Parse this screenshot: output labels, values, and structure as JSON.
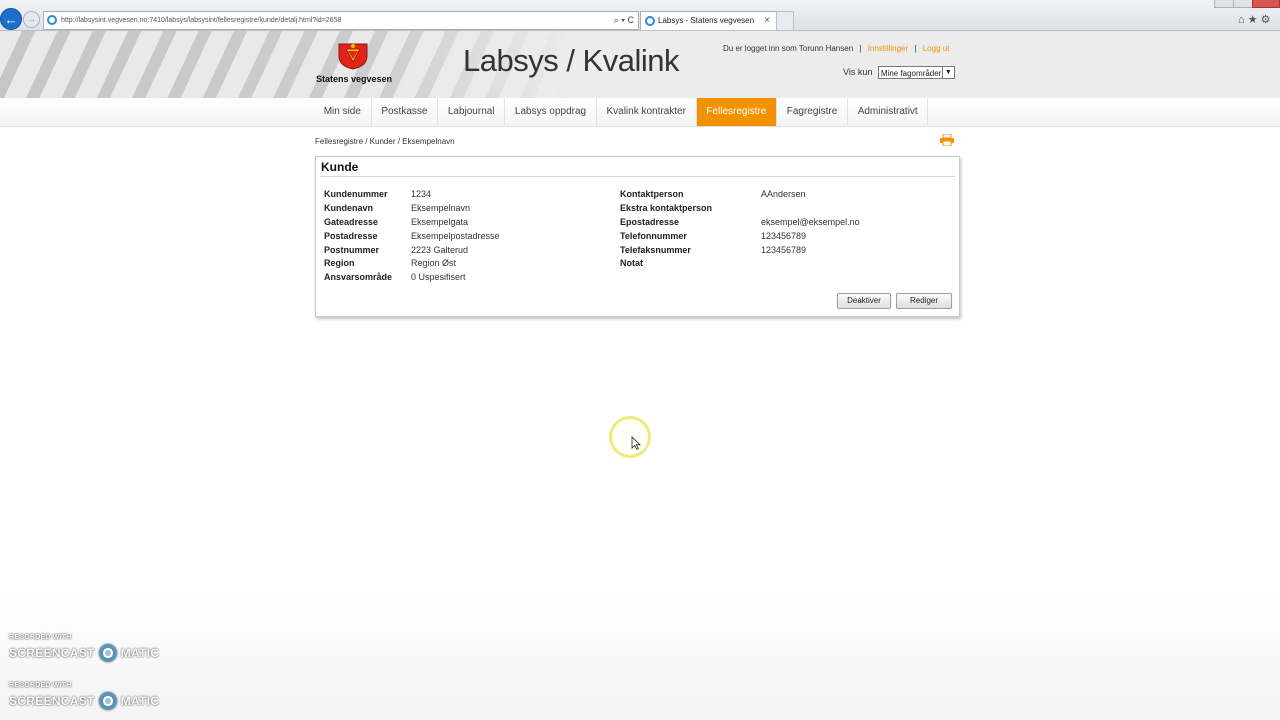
{
  "browser": {
    "url": "http://labsysint.vegvesen.no:7410/labsys/labsysint/fellesregistre/kunde/detalj.html?id=2658",
    "address_tools": "⌕ ▾ C",
    "tab_title": "Labsys - Statens vegvesen",
    "tab_close": "×",
    "right_icons": "⌂ ★ ⚙"
  },
  "header": {
    "logo_text": "Statens vegvesen",
    "app_title": "Labsys / Kvalink",
    "logged_in_text": "Du er logget inn som Torunn Hansen",
    "separator": "|",
    "settings_link": "Innstillinger",
    "logout_link": "Logg ut",
    "filter_label": "Vis kun",
    "filter_value": "Mine fagområder"
  },
  "nav": {
    "items": [
      {
        "label": "Min side"
      },
      {
        "label": "Postkasse"
      },
      {
        "label": "Labjournal"
      },
      {
        "label": "Labsys oppdrag"
      },
      {
        "label": "Kvalink kontrakter"
      },
      {
        "label": "Fellesregistre"
      },
      {
        "label": "Fagregistre"
      },
      {
        "label": "Administrativt"
      }
    ],
    "active": "Fellesregistre",
    "active_color": "#f39200"
  },
  "breadcrumb": "Fellesregistre / Kunder / Eksempelnavn",
  "panel": {
    "title": "Kunde",
    "left_fields": [
      {
        "label": "Kundenummer",
        "value": "1234"
      },
      {
        "label": "Kundenavn",
        "value": "Eksempelnavn"
      },
      {
        "label": "Gateadresse",
        "value": "Eksempelgata"
      },
      {
        "label": "Postadresse",
        "value": "Eksempelpostadresse"
      },
      {
        "label": "Postnummer",
        "value": "2223 Galterud"
      },
      {
        "label": "Region",
        "value": "Region Øst"
      },
      {
        "label": "Ansvarsområde",
        "value": "0 Uspesifisert"
      }
    ],
    "right_fields": [
      {
        "label": "Kontaktperson",
        "value": "AAndersen"
      },
      {
        "label": "Ekstra kontaktperson",
        "value": ""
      },
      {
        "label": "Epostadresse",
        "value": "eksempel@eksempel.no"
      },
      {
        "label": "Telefonnummer",
        "value": "123456789"
      },
      {
        "label": "Telefaksnummer",
        "value": "123456789"
      },
      {
        "label": "Notat",
        "value": ""
      }
    ],
    "deactivate_button": "Deaktiver",
    "edit_button": "Rediger"
  },
  "watermark": {
    "recorded_with": "RECORDED WITH",
    "brand_left": "SCREENCAST",
    "brand_right": "MATIC"
  }
}
